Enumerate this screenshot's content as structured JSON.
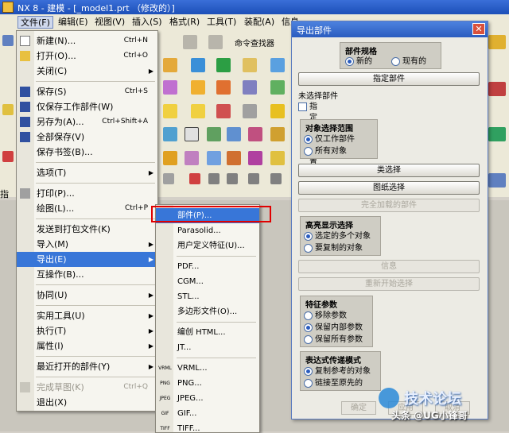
{
  "window": {
    "title": "NX 8 - 建模 - [_model1.prt （修改的）]"
  },
  "menubar": [
    {
      "label": "文件(F)",
      "active": true
    },
    {
      "label": "编辑(E)"
    },
    {
      "label": "视图(V)"
    },
    {
      "label": "插入(S)"
    },
    {
      "label": "格式(R)"
    },
    {
      "label": "工具(T)"
    },
    {
      "label": "装配(A)"
    },
    {
      "label": "信息"
    }
  ],
  "toolbar": {
    "command_finder": "命令查找器",
    "status_left": "指定"
  },
  "file_menu": {
    "items": [
      {
        "label": "新建(N)...",
        "shortcut": "Ctrl+N",
        "icon": "new-file-icon"
      },
      {
        "label": "打开(O)...",
        "shortcut": "Ctrl+O",
        "icon": "open-folder-icon"
      },
      {
        "label": "关闭(C)",
        "submenu": true
      },
      {
        "label": "保存(S)",
        "shortcut": "Ctrl+S",
        "icon": "save-icon"
      },
      {
        "label": "仅保存工作部件(W)",
        "icon": "save-work-part-icon"
      },
      {
        "label": "另存为(A)...",
        "shortcut": "Ctrl+Shift+A",
        "icon": "save-as-icon"
      },
      {
        "label": "全部保存(V)",
        "icon": "save-all-icon"
      },
      {
        "label": "保存书签(B)..."
      },
      {
        "label": "选项(T)",
        "submenu": true
      },
      {
        "label": "打印(P)...",
        "icon": "print-icon"
      },
      {
        "label": "绘图(L)...",
        "shortcut": "Ctrl+P"
      },
      {
        "label": "发送到打包文件(K)"
      },
      {
        "label": "导入(M)",
        "submenu": true
      },
      {
        "label": "导出(E)",
        "submenu": true,
        "highlighted": true
      },
      {
        "label": "互操作(B)..."
      },
      {
        "label": "协同(U)",
        "submenu": true
      },
      {
        "label": "实用工具(U)",
        "submenu": true
      },
      {
        "label": "执行(T)",
        "submenu": true
      },
      {
        "label": "属性(I)",
        "submenu": true
      },
      {
        "label": "最近打开的部件(Y)",
        "submenu": true
      },
      {
        "label": "完成草图(K)",
        "shortcut": "Ctrl+Q",
        "disabled": true
      },
      {
        "label": "退出(X)"
      }
    ]
  },
  "export_submenu": {
    "items": [
      {
        "label": "部件(P)...",
        "highlighted": true
      },
      {
        "label": "Parasolid..."
      },
      {
        "label": "用户定义特征(U)..."
      },
      {
        "label": "PDF..."
      },
      {
        "label": "CGM..."
      },
      {
        "label": "STL..."
      },
      {
        "label": "多边形文件(O)..."
      },
      {
        "label": "编创 HTML..."
      },
      {
        "label": "JT..."
      },
      {
        "label": "VRML...",
        "tag": "VRML"
      },
      {
        "label": "PNG...",
        "tag": "PNG"
      },
      {
        "label": "JPEG...",
        "tag": "JPEG"
      },
      {
        "label": "GIF...",
        "tag": "GIF"
      },
      {
        "label": "TIFF...",
        "tag": "TIFF"
      }
    ]
  },
  "dialog": {
    "title": "导出部件",
    "part_spec": {
      "title": "部件规格",
      "new": "新的",
      "existing": "现有的"
    },
    "specify_part": "指定部件",
    "no_part_selected": "未选择部件",
    "specify_export_location": "指定导出位置",
    "object_scope": {
      "title": "对象选择范围",
      "work_part_only": "仅工作部件",
      "all_objects": "所有对象"
    },
    "class_select": "类选择",
    "drawing_select": "图纸选择",
    "fully_loaded_parts": "完全加载的部件",
    "highlight": {
      "title": "高亮显示选择",
      "selected_multiple": "选定的多个对象",
      "to_copy": "要复制的对象"
    },
    "info": "信息",
    "restart_select": "重新开始选择",
    "feature_params": {
      "title": "特征参数",
      "remove": "移除参数",
      "keep_internal": "保留内部参数",
      "keep_all": "保留所有参数"
    },
    "expr_mode": {
      "title": "表达式传递模式",
      "copy_ref": "复制参考的对象",
      "link_original": "链接至原先的"
    },
    "ok": "确定",
    "apply": "应用",
    "cancel": "取消"
  },
  "watermark": {
    "text": "头条 @UG小锋哥",
    "brand": "技术论坛"
  },
  "colors": {
    "highlight": "#3876d8",
    "titlebar": "#2a5cbf",
    "redbox": "#e00000"
  }
}
